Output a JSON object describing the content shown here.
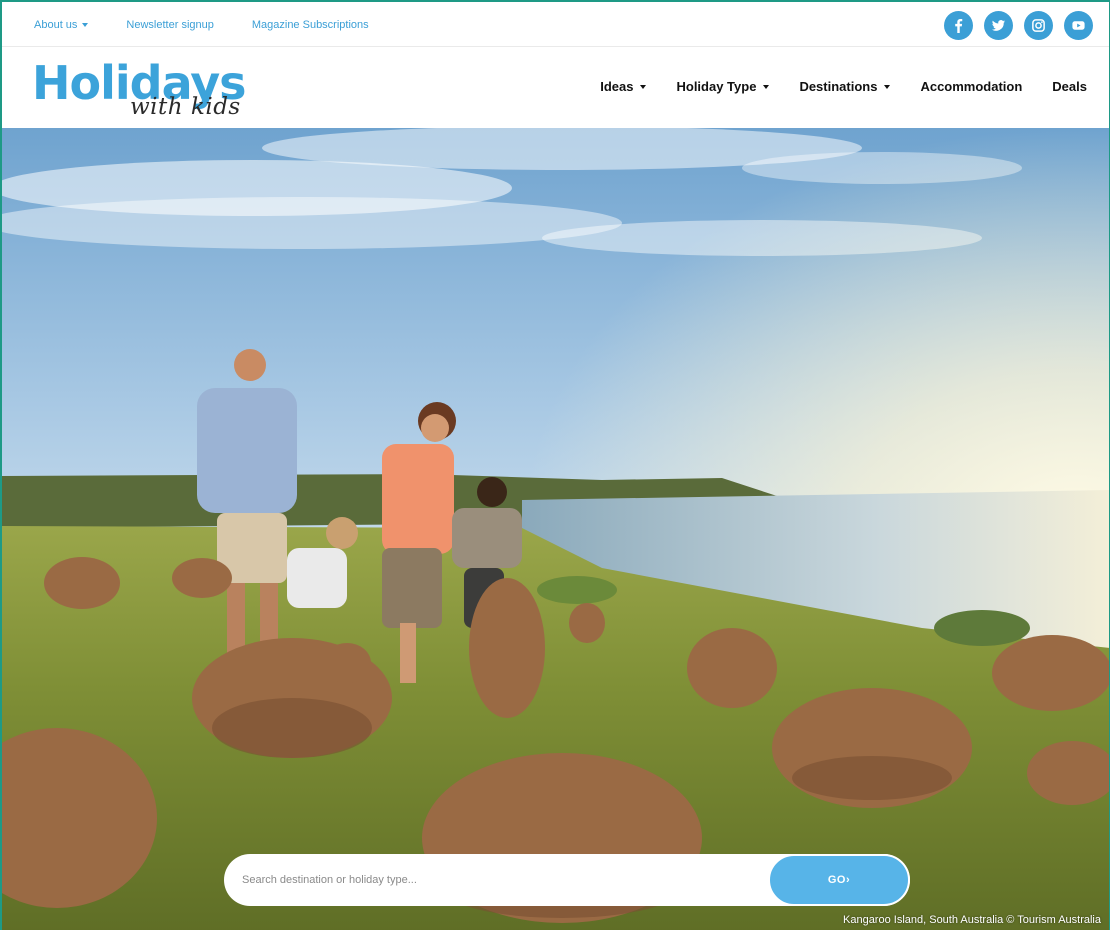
{
  "topbar": {
    "links": [
      {
        "label": "About us",
        "has_dropdown": true
      },
      {
        "label": "Newsletter signup",
        "has_dropdown": false
      },
      {
        "label": "Magazine Subscriptions",
        "has_dropdown": false
      }
    ],
    "socials": [
      "facebook-icon",
      "twitter-icon",
      "instagram-icon",
      "youtube-icon"
    ]
  },
  "logo": {
    "main": "Holidays",
    "sub": "with kids"
  },
  "nav": {
    "items": [
      {
        "label": "Ideas",
        "has_dropdown": true
      },
      {
        "label": "Holiday Type",
        "has_dropdown": true
      },
      {
        "label": "Destinations",
        "has_dropdown": true
      },
      {
        "label": "Accommodation",
        "has_dropdown": false
      },
      {
        "label": "Deals",
        "has_dropdown": false
      }
    ]
  },
  "hero": {
    "search_placeholder": "Search destination or holiday type...",
    "go_label": "GO",
    "credit": "Kangaroo Island, South Australia © Tourism Australia"
  },
  "colors": {
    "brand_blue": "#3ca3da",
    "go_button": "#57b4e8",
    "frame": "#1e9a86"
  }
}
